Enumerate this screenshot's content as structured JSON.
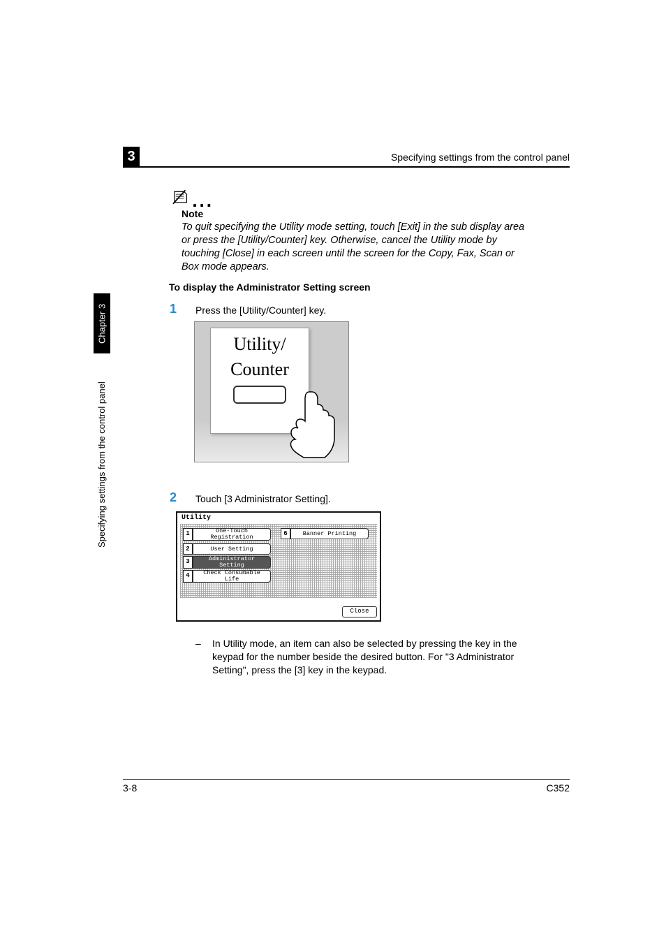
{
  "header": {
    "chapter_num": "3",
    "running_head": "Specifying settings from the control panel"
  },
  "note": {
    "label": "Note",
    "text": "To quit specifying the Utility mode setting, touch [Exit] in the sub display area or press the [Utility/Counter] key. Otherwise, cancel the Utility mode by touching [Close] in each screen until the screen for the Copy, Fax, Scan or Box mode appears."
  },
  "subheading": "To display the Administrator Setting screen",
  "steps": {
    "s1": {
      "num": "1",
      "text": "Press the [Utility/Counter] key.",
      "panel_line1": "Utility/",
      "panel_line2": "Counter"
    },
    "s2": {
      "num": "2",
      "text": "Touch [3 Administrator Setting].",
      "screen_title": "Utility",
      "buttons": {
        "b1_num": "1",
        "b1": "One-Touch Registration",
        "b2_num": "2",
        "b2": "User Setting",
        "b3_num": "3",
        "b3": "Administrator Setting",
        "b4_num": "4",
        "b4": "Check Consumable Life",
        "b6_num": "6",
        "b6": "Banner Printing"
      },
      "close": "Close",
      "bullet": "In Utility mode, an item can also be selected by pressing the key in the keypad for the number beside the desired button. For \"3 Administrator Setting\", press the [3] key in the keypad."
    }
  },
  "sidebar": {
    "tab": "Chapter 3",
    "text": "Specifying settings from the control panel"
  },
  "footer": {
    "left": "3-8",
    "right": "C352"
  }
}
